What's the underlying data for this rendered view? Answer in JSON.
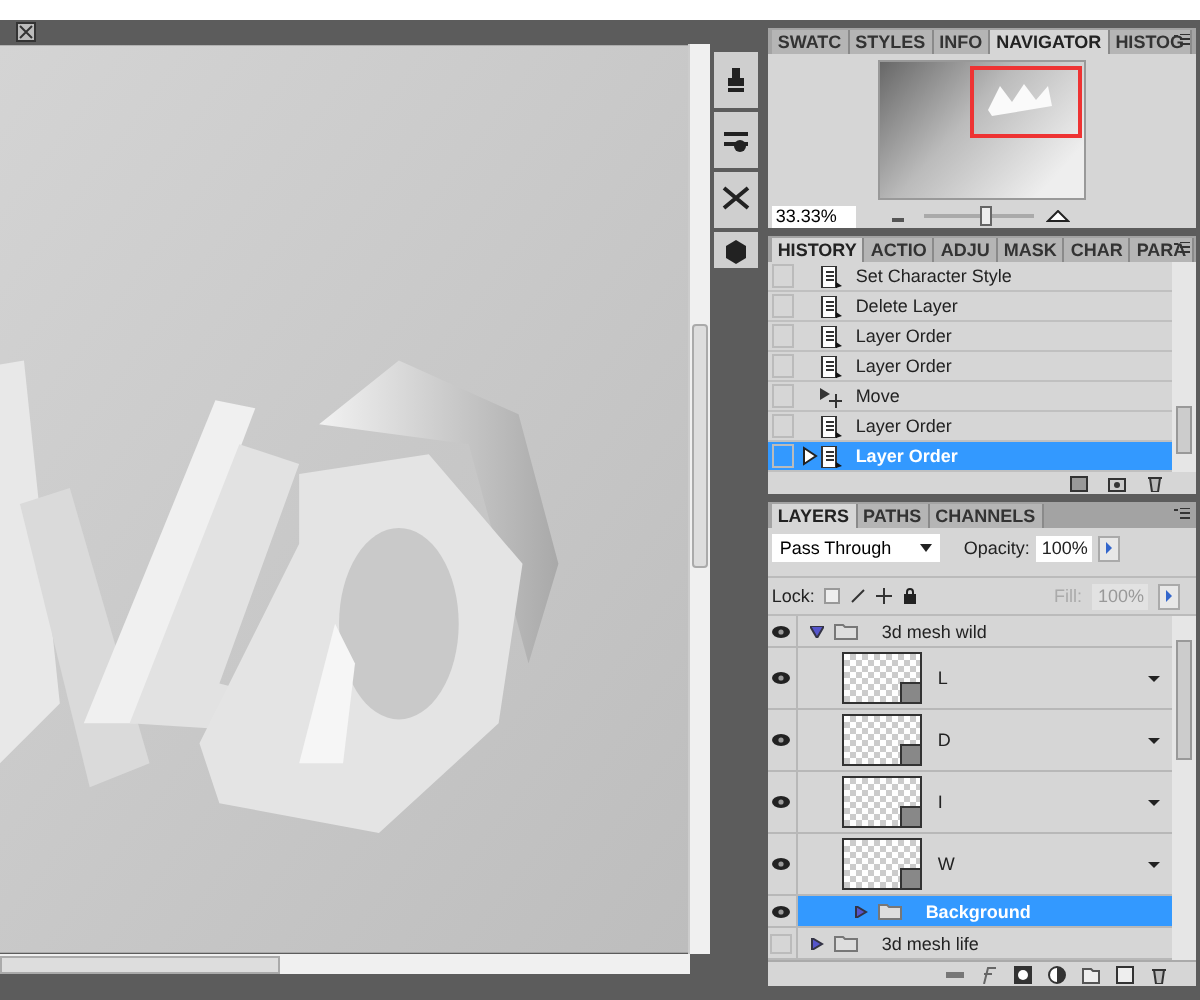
{
  "navigator": {
    "tabs": [
      {
        "label": "SWATC",
        "selected": false
      },
      {
        "label": "STYLES",
        "selected": false
      },
      {
        "label": "INFO",
        "selected": false
      },
      {
        "label": "NAVIGATOR",
        "selected": true
      },
      {
        "label": "HISTOG",
        "selected": false
      }
    ],
    "zoom": "33.33%",
    "level": 0.57
  },
  "history": {
    "tabs": [
      {
        "label": "HISTORY",
        "selected": true
      },
      {
        "label": "ACTIO",
        "selected": false
      },
      {
        "label": "ADJU",
        "selected": false
      },
      {
        "label": "MASK",
        "selected": false
      },
      {
        "label": "CHAR",
        "selected": false
      },
      {
        "label": "PARA",
        "selected": false
      }
    ],
    "items": [
      {
        "label": "Set Character Style",
        "kind": "document",
        "snapshot": false,
        "selected": false
      },
      {
        "label": "Delete Layer",
        "kind": "document",
        "snapshot": false,
        "selected": false
      },
      {
        "label": "Layer Order",
        "kind": "document",
        "snapshot": false,
        "selected": false
      },
      {
        "label": "Layer Order",
        "kind": "document",
        "snapshot": false,
        "selected": false
      },
      {
        "label": "Move",
        "kind": "move",
        "snapshot": false,
        "selected": false
      },
      {
        "label": "Layer Order",
        "kind": "document",
        "snapshot": false,
        "selected": false
      },
      {
        "label": "Layer Order",
        "kind": "document",
        "snapshot": false,
        "selected": true
      }
    ]
  },
  "layers": {
    "tabs": [
      {
        "label": "LAYERS",
        "selected": true
      },
      {
        "label": "PATHS",
        "selected": false
      },
      {
        "label": "CHANNELS",
        "selected": false
      }
    ],
    "blend_mode": "Pass Through",
    "opacity_label": "Opacity:",
    "opacity": "100%",
    "lock_label": "Lock:",
    "fill_label": "Fill:",
    "fill": "100%",
    "fill_disabled": true,
    "items": [
      {
        "name": "3d mesh wild",
        "kind": "group",
        "visible": true,
        "expanded": true,
        "selected": false,
        "children": [
          {
            "name": "L",
            "kind": "mesh",
            "visible": true,
            "selected": false
          },
          {
            "name": "D",
            "kind": "mesh",
            "visible": true,
            "selected": false
          },
          {
            "name": "I",
            "kind": "mesh",
            "visible": true,
            "selected": false
          },
          {
            "name": "W",
            "kind": "mesh",
            "visible": true,
            "selected": false
          },
          {
            "name": "Background",
            "kind": "group",
            "visible": true,
            "expanded": false,
            "selected": true
          }
        ]
      },
      {
        "name": "3d mesh life",
        "kind": "group",
        "visible": false,
        "expanded": false,
        "selected": false
      }
    ]
  }
}
